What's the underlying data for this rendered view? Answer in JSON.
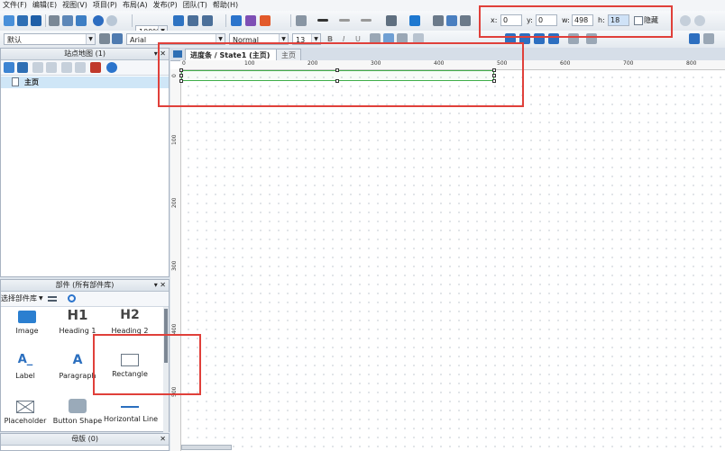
{
  "menu": [
    "文件(F)",
    "编辑(E)",
    "视图(V)",
    "项目(P)",
    "布局(A)",
    "发布(P)",
    "团队(T)",
    "帮助(H)"
  ],
  "toolbar": {
    "zoom": "100%",
    "style": "默认",
    "font": "Arial",
    "weight": "Normal",
    "size": "13"
  },
  "position": {
    "x_label": "x:",
    "x": "0",
    "y_label": "y:",
    "y": "0",
    "w_label": "w:",
    "w": "498",
    "h_label": "h:",
    "h": "18",
    "hide_label": "隐藏"
  },
  "sitemap": {
    "title": "站点地图 (1)",
    "items": [
      "主页"
    ]
  },
  "widgets": {
    "title": "部件 (所有部件库)",
    "library_select": "选择部件库",
    "items": [
      {
        "name": "Image",
        "icon": "image-icon"
      },
      {
        "name": "Heading 1",
        "icon": "heading1-icon",
        "glyph": "H1"
      },
      {
        "name": "Heading 2",
        "icon": "heading2-icon",
        "glyph": "H2"
      },
      {
        "name": "Label",
        "icon": "label-icon",
        "glyph": "A_"
      },
      {
        "name": "Paragraph",
        "icon": "paragraph-icon",
        "glyph": "A"
      },
      {
        "name": "Rectangle",
        "icon": "rectangle-icon"
      },
      {
        "name": "Placeholder",
        "icon": "placeholder-icon"
      },
      {
        "name": "Button Shape",
        "icon": "button-shape-icon"
      },
      {
        "name": "Horizontal Line",
        "icon": "horizontal-line-icon"
      }
    ]
  },
  "masters": {
    "title": "母版 (0)"
  },
  "tabs": [
    {
      "label": "进度条 / State1 (主页)",
      "active": true
    },
    {
      "label": "主页",
      "active": false
    }
  ],
  "ruler": {
    "h": [
      "0",
      "100",
      "200",
      "300",
      "400",
      "500",
      "600",
      "700",
      "800"
    ],
    "v": [
      "0",
      "100",
      "200",
      "300",
      "400",
      "500"
    ]
  },
  "colors": {
    "highlight": "#e0403a",
    "selection": "#3fae49",
    "selected_row": "#cfe6f7"
  }
}
